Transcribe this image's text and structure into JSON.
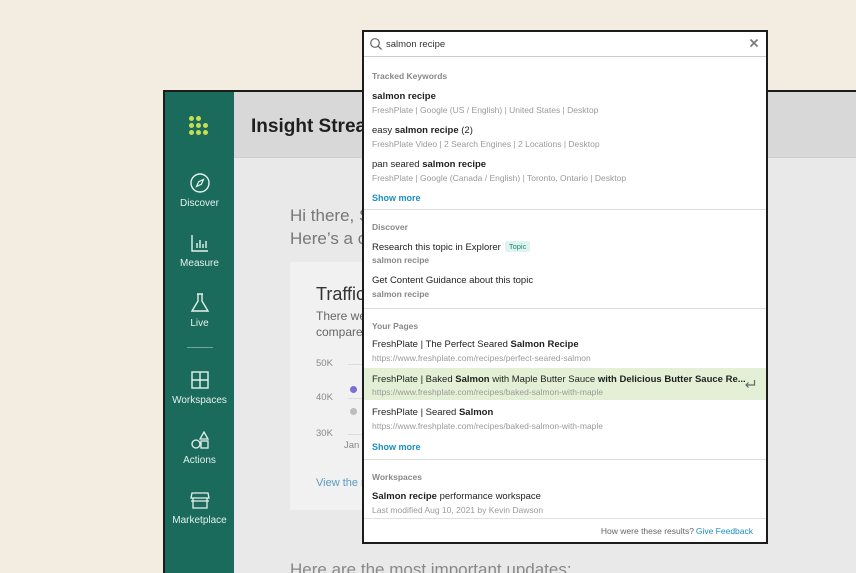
{
  "app": {
    "title": "Insight Strea",
    "nav": [
      {
        "label": "Discover",
        "icon": "compass-icon"
      },
      {
        "label": "Measure",
        "icon": "bar-chart-icon"
      },
      {
        "label": "Live",
        "icon": "flask-icon"
      },
      {
        "label": "Workspaces",
        "icon": "grid-icon"
      },
      {
        "label": "Actions",
        "icon": "shapes-icon"
      },
      {
        "label": "Marketplace",
        "icon": "store-icon"
      }
    ],
    "greeting_line1": "Hi there, S",
    "greeting_line2": "Here’s a c",
    "card": {
      "title": "Traffic",
      "sub_line1": "There we",
      "sub_line2": "compare",
      "y_ticks": [
        "50K",
        "40K",
        "30K"
      ],
      "x_tick": "Jan",
      "link": "View the r"
    },
    "bottom_text": "Here are the most important updates:",
    "colors": {
      "sidebar": "#1a6b5c",
      "logo": "#c7dd53"
    }
  },
  "search": {
    "query": "salmon recipe",
    "placeholder": "Search"
  },
  "sections": {
    "tracked": {
      "heading": "Tracked Keywords",
      "items": [
        {
          "pre": "",
          "bold": "salmon recipe",
          "post": "",
          "meta": "FreshPlate | Google (US / English) | United States | Desktop"
        },
        {
          "pre": "easy ",
          "bold": "salmon recipe",
          "post": " (2)",
          "meta": "FreshPlate Video | 2 Search Engines | 2 Locations | Desktop"
        },
        {
          "pre": "pan seared ",
          "bold": "salmon recipe",
          "post": "",
          "meta": "FreshPlate | Google (Canada / English) | Toronto, Ontario | Desktop"
        }
      ],
      "show_more": "Show more"
    },
    "discover": {
      "heading": "Discover",
      "items": [
        {
          "title": "Research this topic in Explorer",
          "tag": "Topic",
          "sub": "salmon recipe"
        },
        {
          "title": "Get Content Guidance about this topic",
          "sub": "salmon recipe"
        }
      ]
    },
    "pages": {
      "heading": "Your Pages",
      "items": [
        {
          "pre": "FreshPlate | The Perfect Seared ",
          "bold": "Salmon Recipe",
          "mid": "",
          "bold2": "",
          "url": "https://www.freshplate.com/recipes/perfect-seared-salmon"
        },
        {
          "pre": "FreshPlate | Baked ",
          "bold": "Salmon",
          "mid": " with Maple Butter Sauce ",
          "bold2": "with Delicious Butter Sauce Re...",
          "url": "https://www.freshplate.com/recipes/baked-salmon-with-maple"
        },
        {
          "pre": "FreshPlate | Seared ",
          "bold": "Salmon",
          "mid": "",
          "bold2": "",
          "url": "https://www.freshplate.com/recipes/baked-salmon-with-maple"
        }
      ],
      "show_more": "Show more"
    },
    "workspaces": {
      "heading": "Workspaces",
      "items": [
        {
          "bold": "Salmon recipe",
          "post": " performance workspace",
          "meta": "Last modified Aug 10, 2021 by Kevin Dawson"
        }
      ]
    }
  },
  "footer": {
    "question": "How were these results?",
    "feedback": "Give Feedback"
  }
}
